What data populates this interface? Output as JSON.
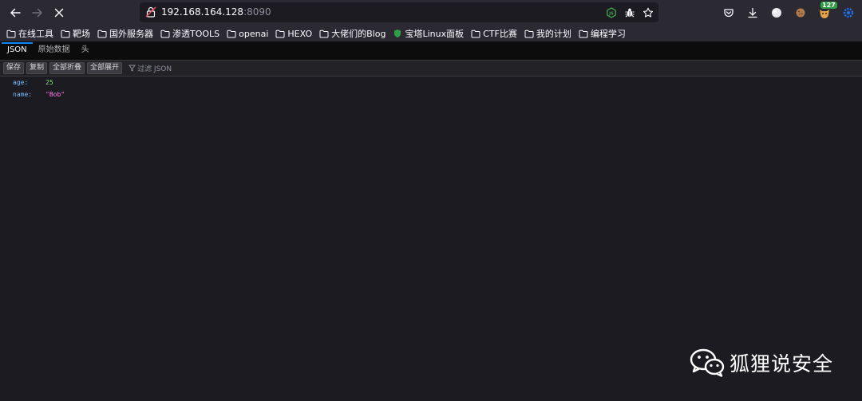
{
  "browser": {
    "url": {
      "host": "192.168.164.128",
      "port": ":8090"
    },
    "extension_badge": "127"
  },
  "bookmarks": [
    {
      "label": "在线工具",
      "icon": "folder-icon"
    },
    {
      "label": "靶场",
      "icon": "folder-icon"
    },
    {
      "label": "国外服务器",
      "icon": "folder-icon"
    },
    {
      "label": "渗透TOOLS",
      "icon": "folder-icon"
    },
    {
      "label": "openai",
      "icon": "folder-icon"
    },
    {
      "label": "HEXO",
      "icon": "folder-icon"
    },
    {
      "label": "大佬们的Blog",
      "icon": "folder-icon"
    },
    {
      "label": "宝塔Linux面板",
      "icon": "shield-icon"
    },
    {
      "label": "CTF比赛",
      "icon": "folder-icon"
    },
    {
      "label": "我的计划",
      "icon": "folder-icon"
    },
    {
      "label": "编程学习",
      "icon": "folder-icon"
    }
  ],
  "json_viewer": {
    "tabs": [
      "JSON",
      "原始数据",
      "头"
    ],
    "active_tab": "JSON",
    "toolbar": {
      "save": "保存",
      "copy": "复制",
      "collapse_all": "全部折叠",
      "expand_all": "全部展开",
      "filter_placeholder": "过滤 JSON"
    },
    "rows": [
      {
        "key": "age:",
        "value": "25",
        "type": "number"
      },
      {
        "key": "name:",
        "value": "\"Bob\"",
        "type": "string"
      }
    ]
  },
  "watermark": {
    "text": "狐狸说安全"
  },
  "colors": {
    "toolbar_bg": "#2b2a33",
    "content_bg": "#1c1b22",
    "accent": "#0a84ff",
    "json_key": "#75bfff",
    "json_number": "#86de74",
    "json_string": "#ff7de9"
  }
}
